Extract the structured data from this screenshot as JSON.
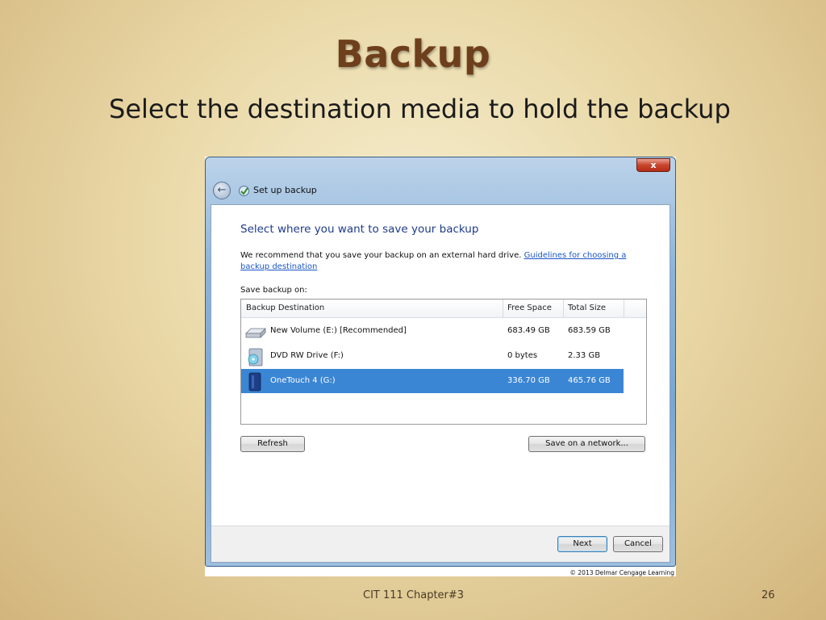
{
  "slide": {
    "title": "Backup",
    "subtitle": "Select the destination media to hold the backup",
    "footer": "CIT 111 Chapter#3",
    "page_number": "26"
  },
  "window": {
    "title": "Set up backup",
    "close_label": "x",
    "heading": "Select where you want to save your backup",
    "recommend_text": "We recommend that you save your backup on an external hard drive.",
    "guidelines_link": "Guidelines for choosing a backup destination",
    "save_on_label": "Save backup on:",
    "table": {
      "headers": [
        "Backup Destination",
        "Free Space",
        "Total Size"
      ],
      "rows": [
        {
          "name": "New Volume (E:) [Recommended]",
          "free": "683.49 GB",
          "total": "683.59 GB",
          "icon": "hard-drive-icon",
          "selected": false
        },
        {
          "name": "DVD RW Drive (F:)",
          "free": "0 bytes",
          "total": "2.33 GB",
          "icon": "dvd-drive-icon",
          "selected": false
        },
        {
          "name": "OneTouch 4 (G:)",
          "free": "336.70 GB",
          "total": "465.76 GB",
          "icon": "external-drive-icon",
          "selected": true
        }
      ]
    },
    "refresh_label": "Refresh",
    "network_label": "Save on a network...",
    "next_label": "Next",
    "cancel_label": "Cancel",
    "credit": "© 2013 Delmar Cengage Learning"
  },
  "colors": {
    "selection": "#3b86d4",
    "title_brown": "#6e3f1c",
    "link": "#1a56c7"
  }
}
